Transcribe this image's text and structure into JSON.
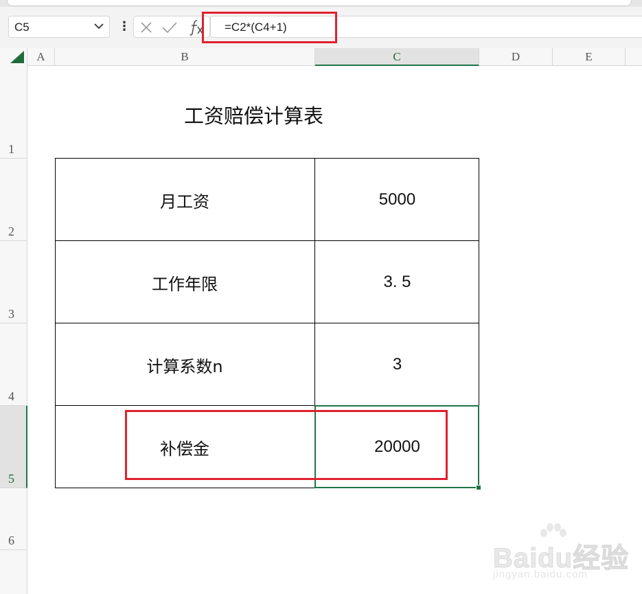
{
  "formula_bar": {
    "name_box": "C5",
    "formula": "=C2*(C4+1)"
  },
  "columns": [
    "A",
    "B",
    "C",
    "D",
    "E"
  ],
  "rows": [
    "1",
    "2",
    "3",
    "4",
    "5",
    "6"
  ],
  "sheet": {
    "title": "工资赔偿计算表",
    "table": [
      {
        "label": "月工资",
        "value": "5000"
      },
      {
        "label": "工作年限",
        "value": "3. 5"
      },
      {
        "label": "计算系数n",
        "value": "3"
      },
      {
        "label": "补偿金",
        "value": "20000"
      }
    ]
  },
  "watermark": {
    "brand": "Baidu经验",
    "url": "jingyan.baidu.com"
  },
  "colors": {
    "accent_green": "#217346",
    "highlight_red": "#e0202e"
  }
}
